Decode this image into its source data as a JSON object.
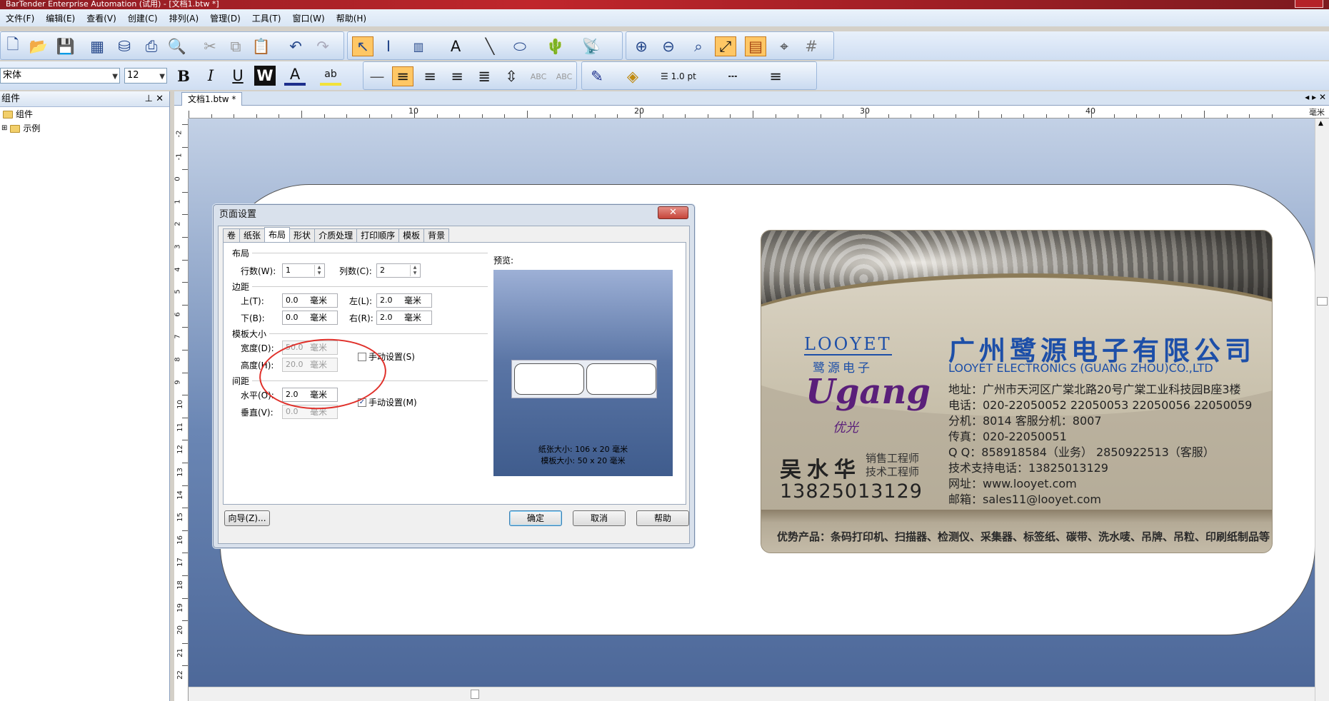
{
  "window": {
    "title": "BarTender Enterprise Automation (试用) - [文档1.btw *]"
  },
  "menu": [
    "文件(F)",
    "编辑(E)",
    "查看(V)",
    "创建(C)",
    "排列(A)",
    "管理(D)",
    "工具(T)",
    "窗口(W)",
    "帮助(H)"
  ],
  "format_toolbar": {
    "font": "宋体",
    "size": "12",
    "line_width": "1.0 pt"
  },
  "left_panel": {
    "title": "组件",
    "items": [
      "组件",
      "示例"
    ]
  },
  "document": {
    "tab": "文档1.btw *",
    "unit": "毫米"
  },
  "ruler": {
    "h": [
      "10",
      "20",
      "30",
      "40"
    ],
    "v": [
      "-2",
      "-1",
      "0",
      "1",
      "2",
      "3",
      "4",
      "5",
      "6",
      "7",
      "8",
      "9",
      "10",
      "11",
      "12",
      "13",
      "14",
      "15",
      "16",
      "17",
      "18",
      "19",
      "20",
      "21",
      "22"
    ]
  },
  "dialog": {
    "title": "页面设置",
    "tabs": [
      "卷",
      "纸张",
      "布局",
      "形状",
      "介质处理",
      "打印顺序",
      "模板",
      "背景"
    ],
    "active_tab": "布局",
    "group_layout": "布局",
    "rows_label": "行数(W):",
    "rows_value": "1",
    "cols_label": "列数(C):",
    "cols_value": "2",
    "group_margin": "边距",
    "top_label": "上(T):",
    "top_value": "0.0",
    "left_label": "左(L):",
    "left_value": "2.0",
    "bottom_label": "下(B):",
    "bottom_value": "0.0",
    "right_label": "右(R):",
    "right_value": "2.0",
    "group_template": "模板大小",
    "width_label": "宽度(D):",
    "width_value": "50.0",
    "height_label": "高度(H):",
    "height_value": "20.0",
    "manual_s": "手动设置(S)",
    "group_spacing": "间距",
    "horiz_label": "水平(O):",
    "horiz_value": "2.0",
    "vert_label": "垂直(V):",
    "vert_value": "0.0",
    "manual_m": "手动设置(M)",
    "unit": "毫米",
    "preview_label": "预览:",
    "paper_size": "纸张大小:  106 x 20 毫米",
    "template_size": "模板大小:  50 x 20 毫米",
    "wizard": "向导(Z)...",
    "ok": "确定",
    "cancel": "取消",
    "help": "帮助"
  },
  "card": {
    "brand_en": "LOOYET",
    "brand_cn": "鹭源电子",
    "brand_script": "Ugang",
    "brand_script_cn": "优光",
    "company_cn": "广州鹭源电子有限公司",
    "company_en": "LOOYET ELECTRONICS (GUANG ZHOU)CO.,LTD",
    "address": "地址：广州市天河区广棠北路20号广棠工业科技园B座3楼",
    "tel": "电话：020-22050052  22050053  22050056  22050059",
    "ext": "分机：8014    客服分机：8007",
    "fax": "传真：020-22050051",
    "qq": "Q Q：858918584（业务）  2850922513（客服）",
    "support": "技术支持电话：13825013129",
    "web": "网址：www.looyet.com",
    "email": "邮箱：sales11@looyet.com",
    "person": "吴水华",
    "title1": "销售工程师",
    "title2": "技术工程师",
    "mobile": "13825013129",
    "products": "优势产品：条码打印机、扫描器、检测仪、采集器、标签纸、碳带、洗水唛、吊牌、吊粒、印刷纸制品等"
  },
  "colors": {
    "title_red": "#a01f25",
    "card_blue": "#1d4fa8",
    "canvas_blue": "#6a86b4"
  }
}
